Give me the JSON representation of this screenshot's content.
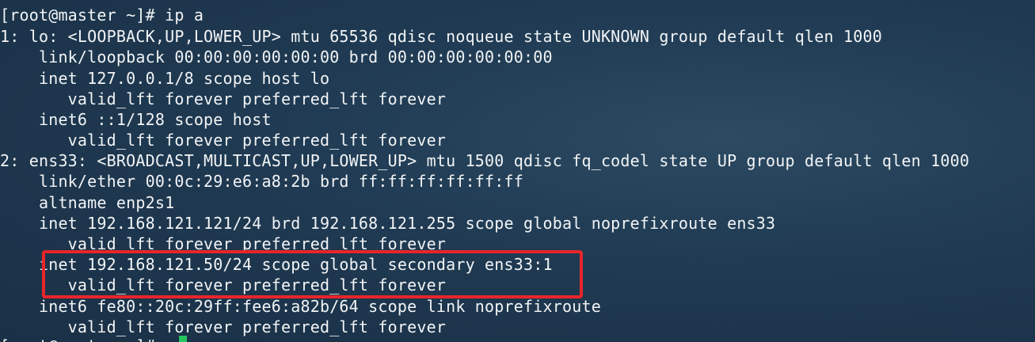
{
  "terminal": {
    "lines": [
      "[root@master ~]# ip a",
      "1: lo: <LOOPBACK,UP,LOWER_UP> mtu 65536 qdisc noqueue state UNKNOWN group default qlen 1000",
      "    link/loopback 00:00:00:00:00:00 brd 00:00:00:00:00:00",
      "    inet 127.0.0.1/8 scope host lo",
      "       valid_lft forever preferred_lft forever",
      "    inet6 ::1/128 scope host",
      "       valid_lft forever preferred_lft forever",
      "2: ens33: <BROADCAST,MULTICAST,UP,LOWER_UP> mtu 1500 qdisc fq_codel state UP group default qlen 1000",
      "    link/ether 00:0c:29:e6:a8:2b brd ff:ff:ff:ff:ff:ff",
      "    altname enp2s1",
      "    inet 192.168.121.121/24 brd 192.168.121.255 scope global noprefixroute ens33",
      "       valid_lft forever preferred_lft forever",
      "    inet 192.168.121.50/24 scope global secondary ens33:1",
      "       valid_lft forever preferred_lft forever",
      "    inet6 fe80::20c:29ff:fee6:a82b/64 scope link noprefixroute",
      "       valid_lft forever preferred_lft forever",
      "[root@master ~]# "
    ],
    "colors": {
      "text": "#f2f4f6",
      "highlight_border": "#e8252a",
      "cursor": "#22c55e"
    }
  }
}
